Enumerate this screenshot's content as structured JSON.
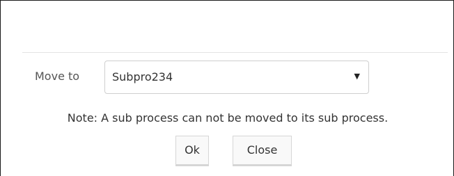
{
  "form": {
    "move_to_label": "Move to",
    "selected_value": "Subpro234",
    "dropdown_arrow": "▼"
  },
  "note": "Note: A sub process can not be moved to its sub process.",
  "buttons": {
    "ok": "Ok",
    "close": "Close"
  },
  "icons": {
    "dropdown": "chevron-down-icon"
  }
}
